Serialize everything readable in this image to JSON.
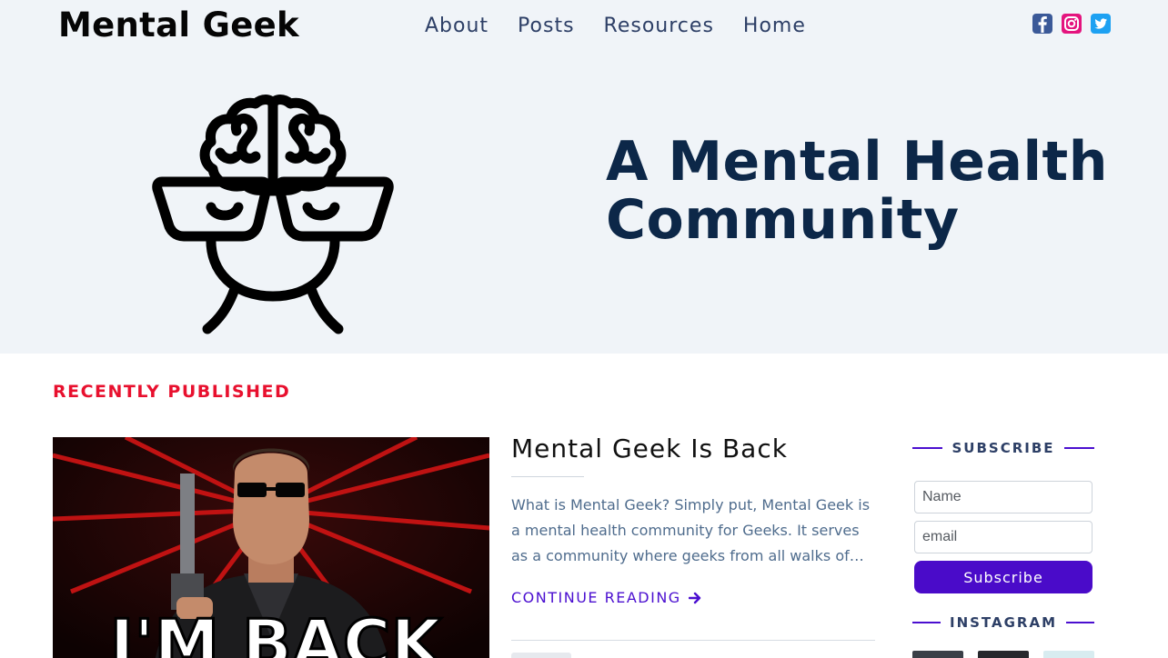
{
  "site": {
    "logo": "Mental Geek",
    "nav": [
      "About",
      "Posts",
      "Resources",
      "Home"
    ],
    "social_icons": [
      "facebook-icon",
      "instagram-icon",
      "twitter-icon"
    ]
  },
  "hero": {
    "title": "A Mental Health Community",
    "art_icon": "brain-geek-glasses-icon"
  },
  "recent": {
    "label": "RECENTLY PUBLISHED",
    "post": {
      "image_text": "I'M BACK",
      "title": "Mental Geek Is Back",
      "excerpt": "What is Mental Geek? Simply put, Mental Geek is a mental health community for Geeks. It serves as a community where geeks from all walks of…",
      "continue": "CONTINUE READING"
    }
  },
  "sidebar": {
    "subscribe_label": "SUBSCRIBE",
    "name_placeholder": "Name",
    "email_placeholder": "email",
    "subscribe_button": "Subscribe",
    "instagram_label": "INSTAGRAM"
  },
  "colors": {
    "accent": "#4a0bc9",
    "section_red": "#e8102e",
    "heading_navy": "#0c2748",
    "header_bg": "#f0f4f8"
  }
}
